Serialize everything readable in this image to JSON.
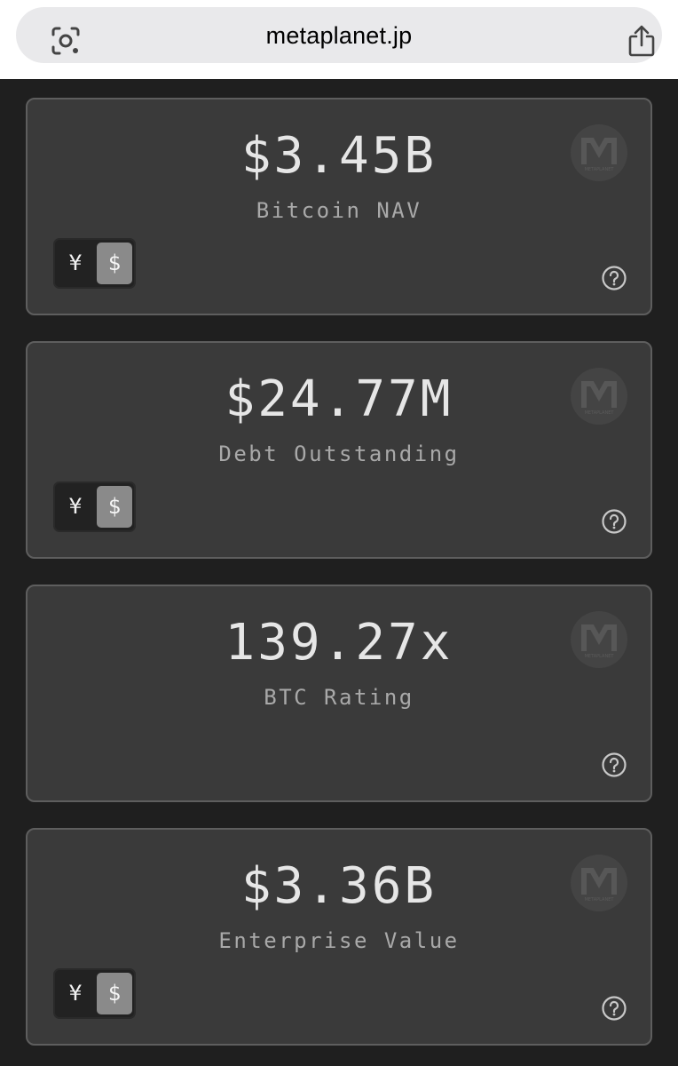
{
  "browser": {
    "url": "metaplanet.jp",
    "lens_icon": "camera-search-icon",
    "share_icon": "share-icon"
  },
  "toggle": {
    "yen_label": "¥",
    "usd_label": "$",
    "selected": "$"
  },
  "cards": [
    {
      "value": "$3.45B",
      "label": "Bitcoin NAV",
      "has_toggle": true
    },
    {
      "value": "$24.77M",
      "label": "Debt Outstanding",
      "has_toggle": true
    },
    {
      "value": "139.27x",
      "label": "BTC Rating",
      "has_toggle": false
    },
    {
      "value": "$3.36B",
      "label": "Enterprise Value",
      "has_toggle": true
    }
  ],
  "colors": {
    "page_bg": "#1f1f1f",
    "card_bg": "#3a3a3a",
    "card_border": "#5e5e5e",
    "value_text": "#e6e6e6",
    "label_text": "#a9a9a9",
    "toggle_active": "#8a8a8a"
  },
  "logo": {
    "icon": "metaplanet-logo-icon",
    "text": "METAPLANET"
  }
}
